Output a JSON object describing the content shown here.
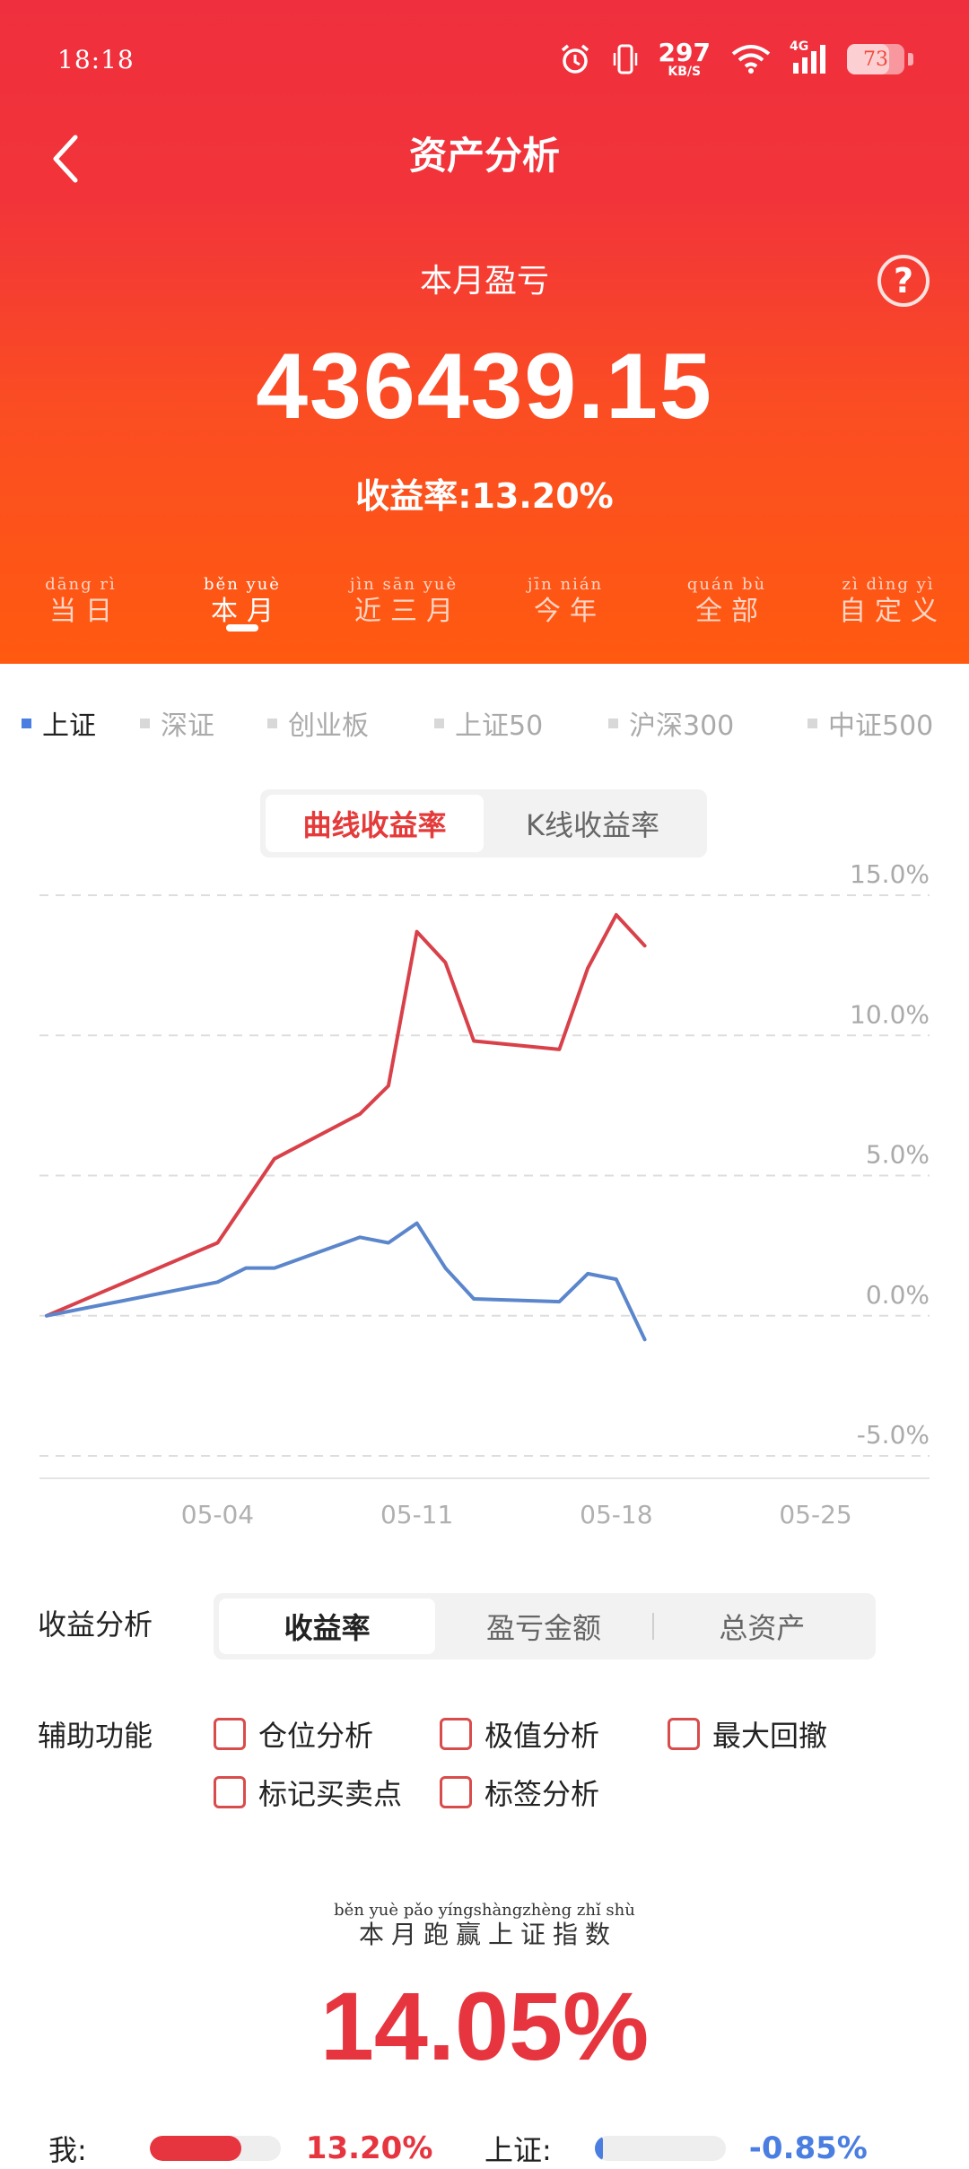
{
  "status_bar": {
    "time": "18:18",
    "net_speed": "297",
    "net_unit": "KB/S",
    "network": "4G",
    "battery": "73",
    "icons": [
      "alarm-icon",
      "vibrate-icon",
      "wifi-icon",
      "signal-icon",
      "battery-icon"
    ]
  },
  "nav": {
    "title": "资产分析",
    "back_icon": "chevron-left-icon"
  },
  "summary": {
    "label": "本月盈亏",
    "amount": "436439.15",
    "rate_text": "收益率:13.20%",
    "help_glyph": "?"
  },
  "period_tabs": [
    {
      "pinyin": "dāng rì",
      "label": "当日",
      "active": false
    },
    {
      "pinyin": "běn yuè",
      "label": "本月",
      "active": true
    },
    {
      "pinyin": "jìn sān yuè",
      "label": "近三月",
      "active": false
    },
    {
      "pinyin": "jīn nián",
      "label": "今年",
      "active": false
    },
    {
      "pinyin": "quán bù",
      "label": "全部",
      "active": false
    },
    {
      "pinyin": "zì dìng yì",
      "label": "自定义",
      "active": false
    }
  ],
  "index_filters": [
    {
      "label": "上证",
      "active": true
    },
    {
      "label": "深证",
      "active": false
    },
    {
      "label": "创业板",
      "active": false
    },
    {
      "label": "上证50",
      "active": false
    },
    {
      "label": "沪深300",
      "active": false
    },
    {
      "label": "中证500",
      "active": false
    }
  ],
  "chart_toggle": {
    "curve": "曲线收益率",
    "kline": "K线收益率",
    "active": "curve"
  },
  "chart_data": {
    "type": "line",
    "y_unit": "%",
    "ylim": [
      -5,
      15
    ],
    "yticks": [
      "15.0%",
      "10.0%",
      "5.0%",
      "0.0%",
      "-5.0%"
    ],
    "ytick_values": [
      15,
      10,
      5,
      0,
      -5
    ],
    "xticks": [
      "05-04",
      "05-11",
      "05-18",
      "05-25"
    ],
    "xtick_days": [
      4,
      11,
      18,
      25
    ],
    "xlim_days": [
      -2,
      29
    ],
    "grid": true,
    "series": [
      {
        "color": "#d9414a",
        "points": [
          [
            -2,
            0.0
          ],
          [
            4,
            2.6
          ],
          [
            6,
            5.6
          ],
          [
            9,
            7.2
          ],
          [
            10,
            8.2
          ],
          [
            11,
            13.7
          ],
          [
            12,
            12.6
          ],
          [
            13,
            9.8
          ],
          [
            16,
            9.5
          ],
          [
            17,
            12.4
          ],
          [
            18,
            14.3
          ],
          [
            19,
            13.2
          ]
        ]
      },
      {
        "color": "#5b86cc",
        "points": [
          [
            -2,
            0.0
          ],
          [
            4,
            1.2
          ],
          [
            5,
            1.7
          ],
          [
            6,
            1.7
          ],
          [
            9,
            2.8
          ],
          [
            10,
            2.6
          ],
          [
            11,
            3.3
          ],
          [
            12,
            1.7
          ],
          [
            13,
            0.6
          ],
          [
            16,
            0.5
          ],
          [
            17,
            1.5
          ],
          [
            18,
            1.3
          ],
          [
            19,
            -0.85
          ]
        ]
      }
    ]
  },
  "analysis": {
    "label": "收益分析",
    "options": [
      "收益率",
      "盈亏金额",
      "总资产"
    ],
    "active_index": 0
  },
  "aux": {
    "label": "辅助功能",
    "items": [
      "仓位分析",
      "极值分析",
      "最大回撤",
      "标记买卖点",
      "标签分析"
    ]
  },
  "outperform": {
    "pinyin": "běn yuè pǎo yíngshàngzhèng zhǐ shù",
    "label": "本月跑赢上证指数",
    "value": "14.05%"
  },
  "compare": {
    "me_label": "我:",
    "me_value": "13.20%",
    "me_color": "#e6353f",
    "me_fraction": 0.7,
    "index_label": "上证:",
    "index_value": "-0.85%",
    "index_color": "#4a7ee0",
    "index_fraction": 0.06
  }
}
